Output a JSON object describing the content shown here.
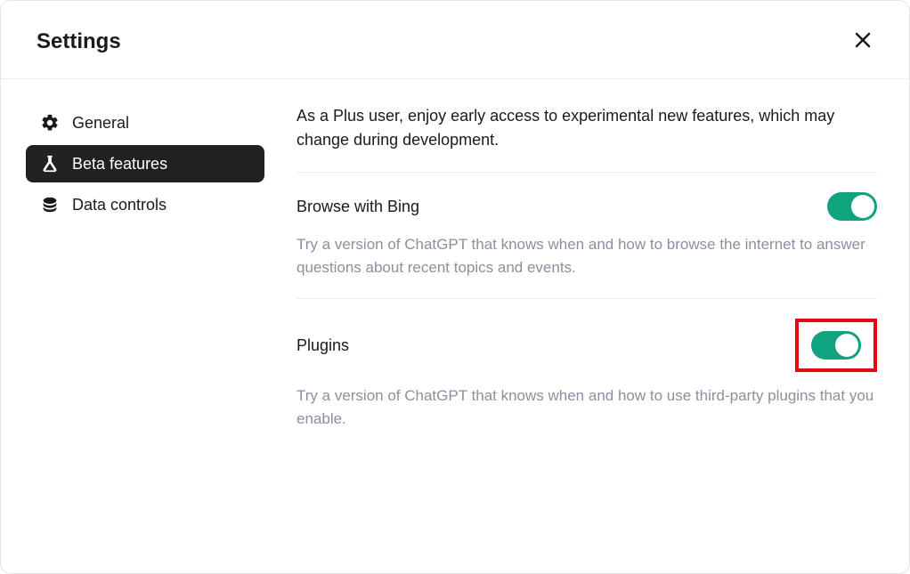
{
  "header": {
    "title": "Settings"
  },
  "sidebar": {
    "items": [
      {
        "label": "General",
        "active": false
      },
      {
        "label": "Beta features",
        "active": true
      },
      {
        "label": "Data controls",
        "active": false
      }
    ]
  },
  "content": {
    "intro": "As a Plus user, enjoy early access to experimental new features, which may change during development.",
    "features": [
      {
        "title": "Browse with Bing",
        "description": "Try a version of ChatGPT that knows when and how to browse the internet to answer questions about recent topics and events.",
        "enabled": true,
        "highlighted": false
      },
      {
        "title": "Plugins",
        "description": "Try a version of ChatGPT that knows when and how to use third-party plugins that you enable.",
        "enabled": true,
        "highlighted": true
      }
    ]
  }
}
